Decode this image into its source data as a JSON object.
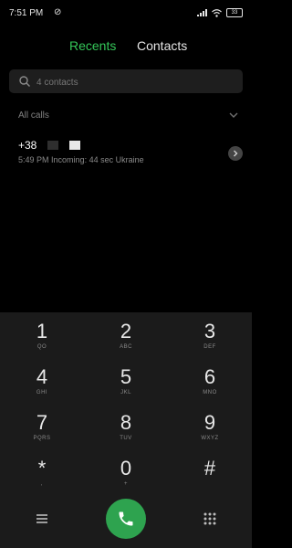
{
  "status": {
    "time": "7:51 PM",
    "battery": "33"
  },
  "tabs": [
    {
      "label": "Recents"
    },
    {
      "label": "Contacts"
    }
  ],
  "search": {
    "placeholder": "4 contacts"
  },
  "filter": {
    "label": "All calls"
  },
  "recent_calls": [
    {
      "number": "+38",
      "time": "5:49 PM",
      "type": "Incoming",
      "duration": "44 sec",
      "location": "Ukraine"
    }
  ],
  "dialpad": {
    "keys": [
      {
        "digit": "1",
        "letters": "QO"
      },
      {
        "digit": "2",
        "letters": "ABC"
      },
      {
        "digit": "3",
        "letters": "DEF"
      },
      {
        "digit": "4",
        "letters": "GHI"
      },
      {
        "digit": "5",
        "letters": "JKL"
      },
      {
        "digit": "6",
        "letters": "MNO"
      },
      {
        "digit": "7",
        "letters": "PQRS"
      },
      {
        "digit": "8",
        "letters": "TUV"
      },
      {
        "digit": "9",
        "letters": "WXYZ"
      },
      {
        "digit": "*",
        "letters": ","
      },
      {
        "digit": "0",
        "letters": "+"
      },
      {
        "digit": "#",
        "letters": ""
      }
    ]
  },
  "colors": {
    "accent": "#34c759",
    "call_button": "#2ea34f",
    "dialpad_bg": "#1b1b1b"
  }
}
